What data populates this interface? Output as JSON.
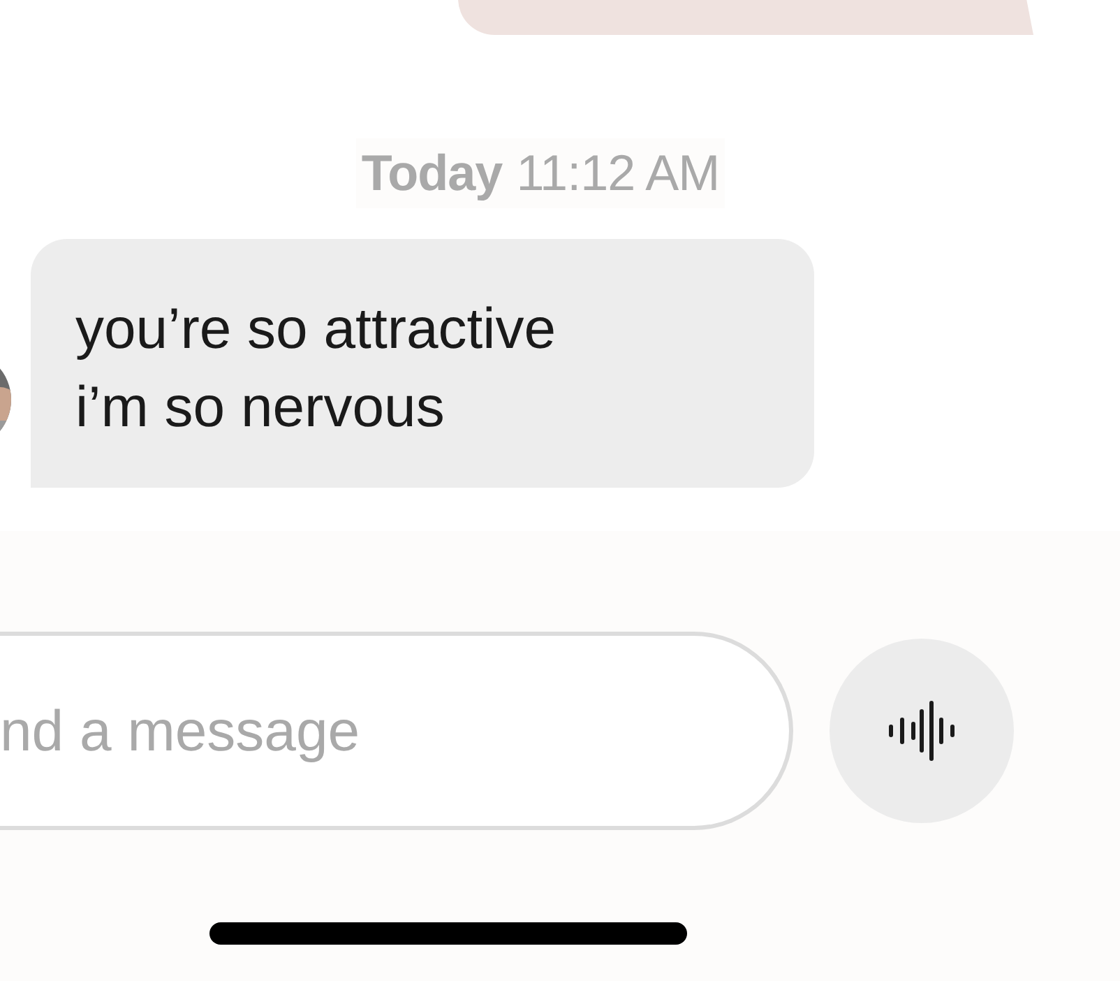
{
  "messages": [
    {
      "kind": "outgoing"
    },
    {
      "kind": "timestamp",
      "day": "Today",
      "time": "11:12 AM"
    },
    {
      "kind": "incoming",
      "lines": [
        "you’re so attractive",
        "i’m so nervous"
      ]
    }
  ],
  "composer": {
    "placeholder": "nd a message"
  }
}
